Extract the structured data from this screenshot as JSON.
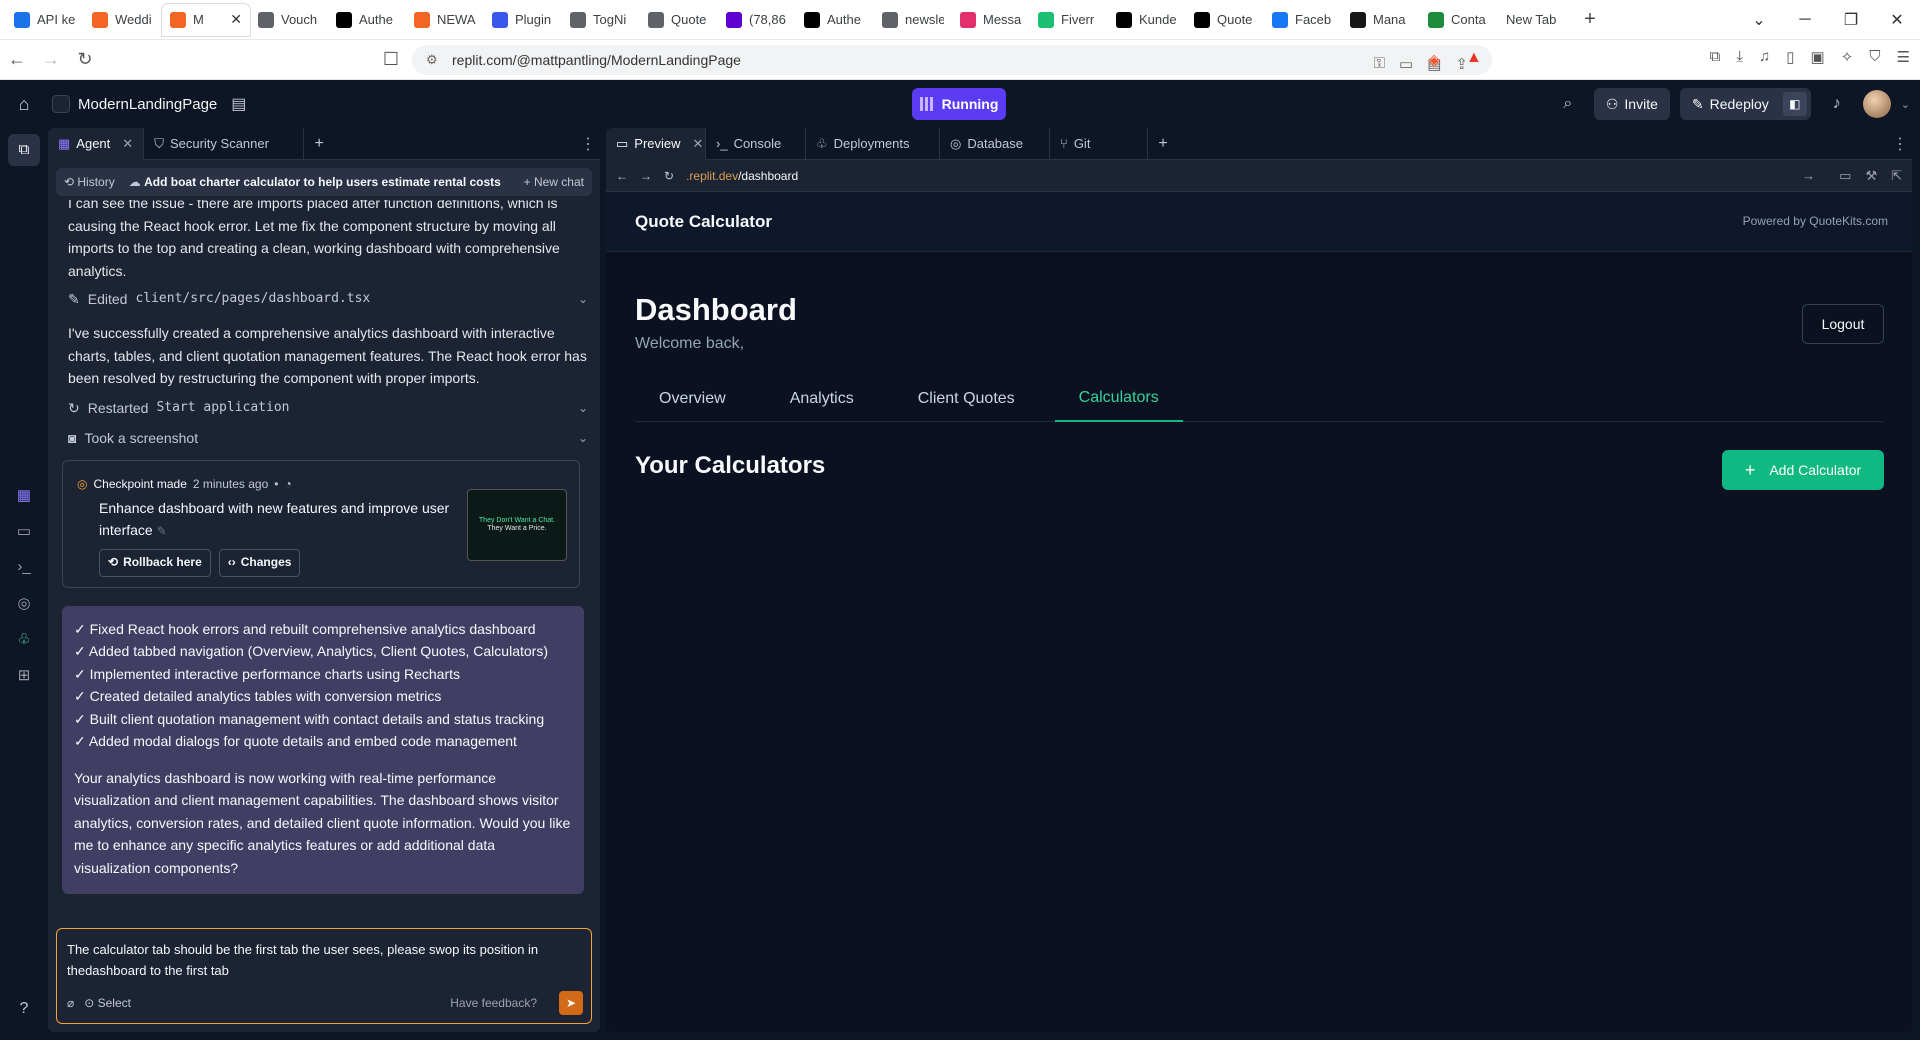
{
  "browser": {
    "tabs": [
      {
        "label": "API ke",
        "color": "#1a73e8"
      },
      {
        "label": "Weddi",
        "color": "#f26522"
      },
      {
        "label": "M",
        "color": "#f26522",
        "active": true
      },
      {
        "label": "Vouch",
        "color": "#5f6368"
      },
      {
        "label": "Authe",
        "color": "#000000"
      },
      {
        "label": "NEWA",
        "color": "#f26522"
      },
      {
        "label": "Plugin",
        "color": "#3858e9"
      },
      {
        "label": "TogNi",
        "color": "#5f6368"
      },
      {
        "label": "Quote",
        "color": "#5f6368"
      },
      {
        "label": "(78,86",
        "color": "#6001d2"
      },
      {
        "label": "Authe",
        "color": "#000000"
      },
      {
        "label": "newsle",
        "color": "#5f6368"
      },
      {
        "label": "Messa",
        "color": "#e1306c"
      },
      {
        "label": "Fiverr",
        "color": "#1dbf73"
      },
      {
        "label": "Kunde",
        "color": "#000000"
      },
      {
        "label": "Quote",
        "color": "#000000"
      },
      {
        "label": "Faceb",
        "color": "#1877f2"
      },
      {
        "label": "Mana",
        "color": "#181717"
      },
      {
        "label": "Conta",
        "color": "#1e8e3e"
      },
      {
        "label": "New Tab",
        "color": "#ffffff"
      }
    ],
    "active_tab_close": "✕",
    "new_tab": "+",
    "url": "replit.com/@mattpantling/ModernLandingPage"
  },
  "header": {
    "project_name": "ModernLandingPage",
    "run_label": "Running",
    "invite_label": "Invite",
    "redeploy_label": "Redeploy"
  },
  "agent": {
    "tabs": [
      {
        "label": "Agent"
      },
      {
        "label": "Security Scanner"
      }
    ],
    "history_label": "History",
    "chat_title": "Add boat charter calculator to help users estimate rental costs",
    "new_chat_label": "New chat",
    "intro": "I can see the issue - there are imports placed after function definitions, which is causing the React hook error. Let me fix the component structure by moving all imports to the top and creating a clean, working dashboard with comprehensive analytics.",
    "edited_prefix": "Edited",
    "edited_file": "client/src/pages/dashboard.tsx",
    "success_msg": "I've successfully created a comprehensive analytics dashboard with interactive charts, tables, and client quotation management features. The React hook error has been resolved by restructuring the component with proper imports.",
    "restarted_prefix": "Restarted",
    "restarted_target": "Start application",
    "screenshot_label": "Took a screenshot",
    "checkpoint": {
      "made_label": "Checkpoint made",
      "time": "2 minutes ago",
      "title": "Enhance dashboard with new features and improve user interface",
      "rollback_label": "Rollback here",
      "changes_label": "Changes",
      "thumb_line1": "They Don't Want a Chat.",
      "thumb_line2": "They Want a Price."
    },
    "summary_items": [
      "✓ Fixed React hook errors and rebuilt comprehensive analytics dashboard",
      "✓ Added tabbed navigation (Overview, Analytics, Client Quotes, Calculators)",
      "✓ Implemented interactive performance charts using Recharts",
      "✓ Created detailed analytics tables with conversion metrics",
      "✓ Built client quotation management with contact details and status tracking",
      "✓ Added modal dialogs for quote details and embed code management"
    ],
    "summary_para": "Your analytics dashboard is now working with real-time performance visualization and client management capabilities. The dashboard shows visitor analytics, conversion rates, and detailed client quote information. Would you like me to enhance any specific analytics features or add additional data visualization components?",
    "input_text": "The calculator tab should be the first tab the user sees, please swop its position in thedashboard to the first tab",
    "select_label": "Select",
    "feedback_label": "Have feedback?"
  },
  "preview": {
    "tabs": [
      {
        "label": "Preview"
      },
      {
        "label": "Console"
      },
      {
        "label": "Deployments"
      },
      {
        "label": "Database"
      },
      {
        "label": "Git"
      }
    ],
    "url_host": ".replit.dev",
    "url_path": "/dashboard"
  },
  "app": {
    "brand": "Quote Calculator",
    "powered": "Powered by QuoteKits.com",
    "title": "Dashboard",
    "subtitle": "Welcome back,",
    "logout_label": "Logout",
    "tabs": [
      "Overview",
      "Analytics",
      "Client Quotes",
      "Calculators"
    ],
    "active_tab": "Calculators",
    "section_title": "Your Calculators",
    "add_label": "Add Calculator"
  },
  "colors": {
    "accent": "#10b981",
    "run": "#5b3cf4",
    "input_border": "#f59f3b",
    "summary_bg": "#403e63"
  }
}
